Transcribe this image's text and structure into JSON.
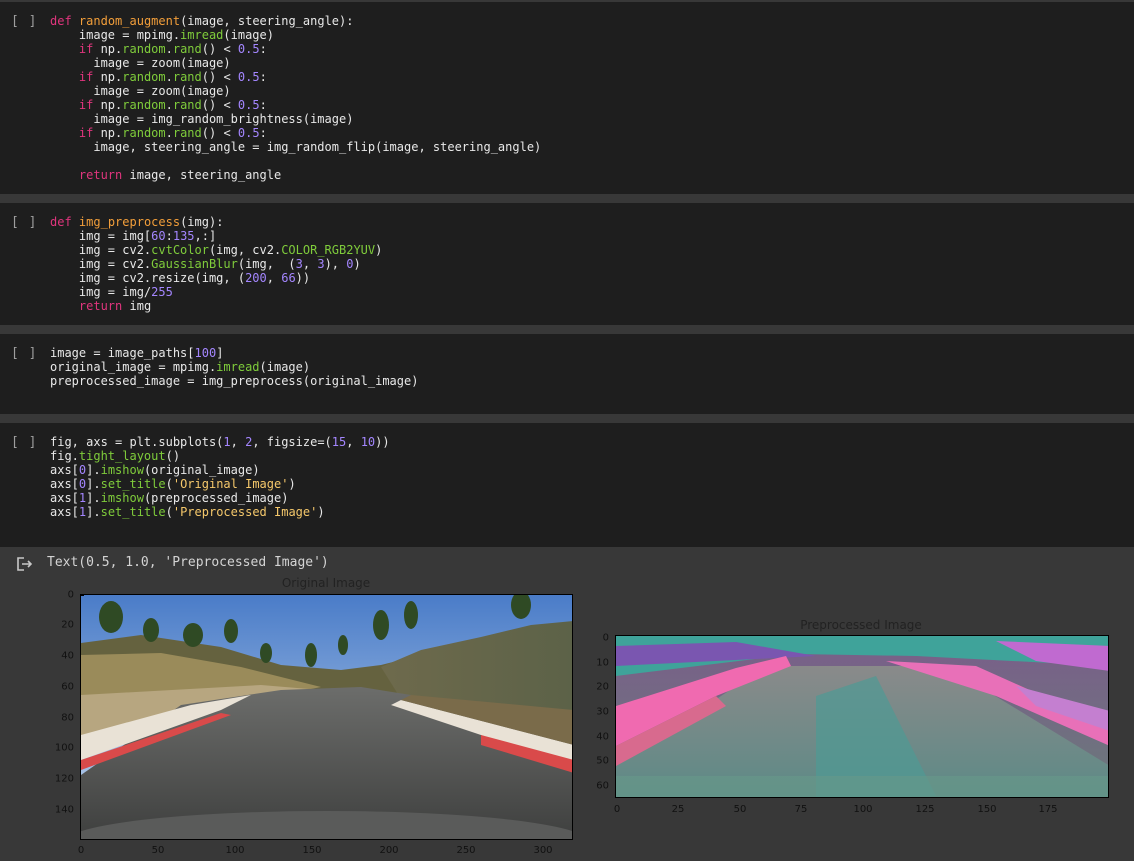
{
  "cells": [
    {
      "run_label": "[ ]"
    },
    {
      "run_label": "[ ]"
    },
    {
      "run_label": "[ ]"
    },
    {
      "run_label": "[ ]"
    }
  ],
  "output": {
    "text": "Text(0.5, 1.0, 'Preprocessed Image')",
    "icon": "output-redirect-icon"
  },
  "plots": {
    "left": {
      "title": "Original Image",
      "y_ticks": [
        "0",
        "20",
        "40",
        "60",
        "80",
        "100",
        "120",
        "140"
      ],
      "x_ticks": [
        "0",
        "50",
        "100",
        "150",
        "200",
        "250",
        "300"
      ]
    },
    "right": {
      "title": "Preprocessed Image",
      "y_ticks": [
        "0",
        "10",
        "20",
        "30",
        "40",
        "50",
        "60"
      ],
      "x_ticks": [
        "0",
        "25",
        "50",
        "75",
        "100",
        "125",
        "150",
        "175"
      ]
    }
  },
  "chart_data": [
    {
      "type": "image",
      "title": "Original Image",
      "xlim": [
        0,
        320
      ],
      "ylim": [
        160,
        0
      ],
      "xticks": [
        0,
        50,
        100,
        150,
        200,
        250,
        300
      ],
      "yticks": [
        0,
        20,
        40,
        60,
        80,
        100,
        120,
        140
      ]
    },
    {
      "type": "image",
      "title": "Preprocessed Image",
      "xlim": [
        0,
        200
      ],
      "ylim": [
        66,
        0
      ],
      "xticks": [
        0,
        25,
        50,
        75,
        100,
        125,
        150,
        175
      ],
      "yticks": [
        0,
        10,
        20,
        30,
        40,
        50,
        60
      ]
    }
  ],
  "colors": {
    "cell_bg": "#1e1e1e",
    "page_bg": "#383838",
    "keyword": "#e0357d",
    "function_name": "#f29e3a",
    "attribute": "#7fcc3b",
    "number": "#a486ff",
    "string": "#f5c86b"
  }
}
